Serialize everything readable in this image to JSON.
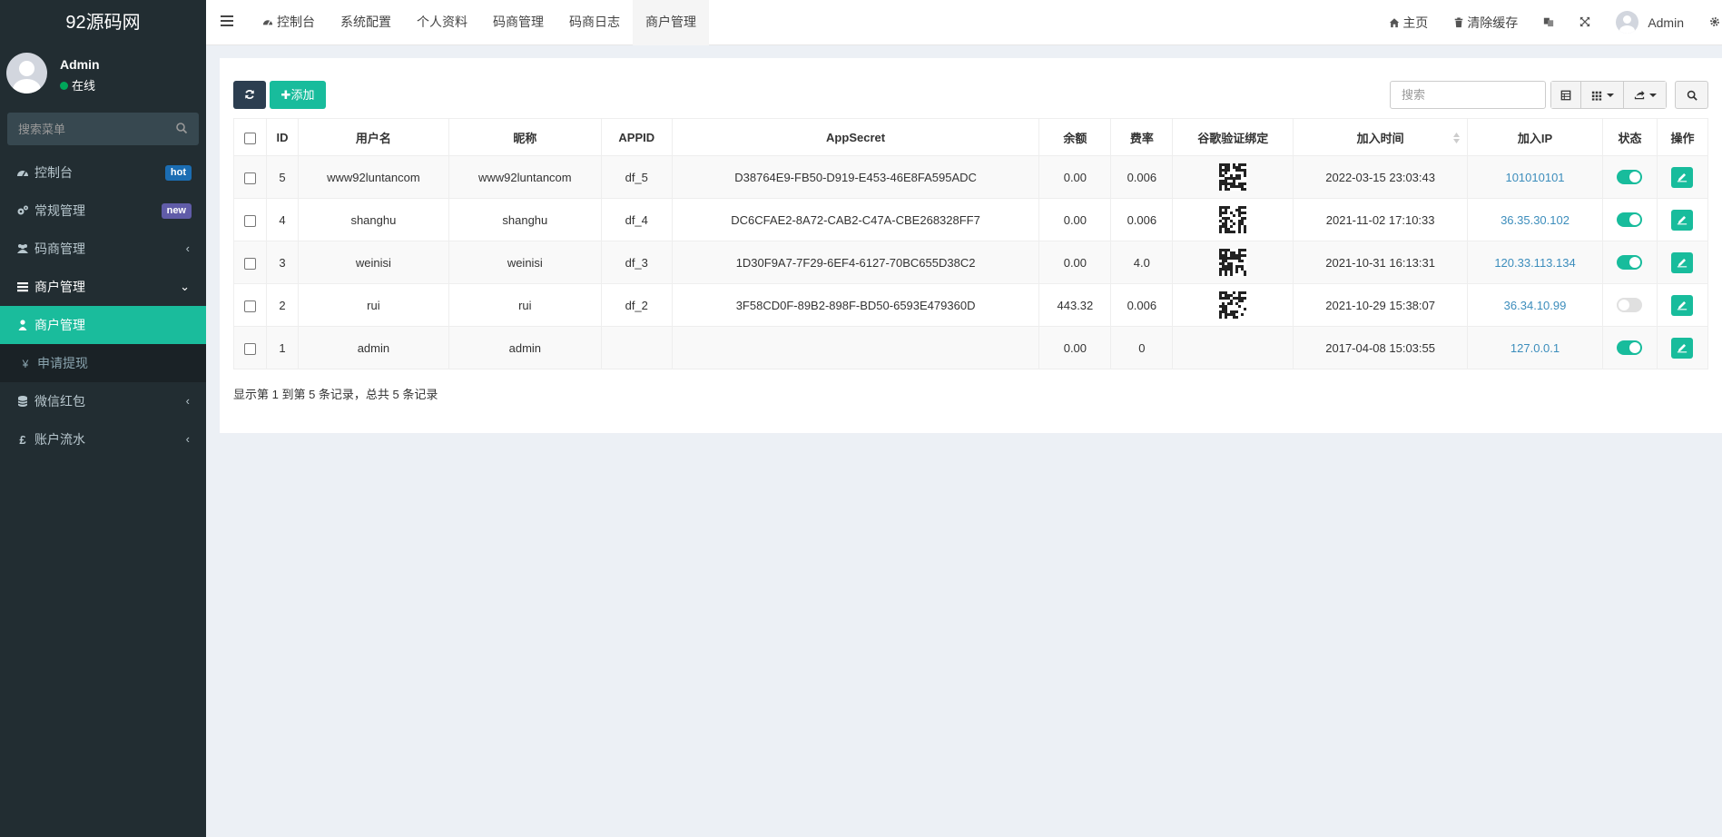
{
  "brand": {
    "title": "92源码网"
  },
  "user": {
    "name": "Admin",
    "status": "在线"
  },
  "sidebar": {
    "search_placeholder": "搜索菜单",
    "items": [
      {
        "label": "控制台",
        "badge": "hot"
      },
      {
        "label": "常规管理",
        "badge": "new"
      },
      {
        "label": "码商管理"
      },
      {
        "label": "商户管理"
      },
      {
        "label": "商户管理"
      },
      {
        "label": "申请提现"
      },
      {
        "label": "微信红包"
      },
      {
        "label": "账户流水"
      }
    ]
  },
  "topbar": {
    "tabs": [
      "控制台",
      "系统配置",
      "个人资料",
      "码商管理",
      "码商日志",
      "商户管理"
    ],
    "home": "主页",
    "clear_cache": "清除缓存",
    "admin": "Admin"
  },
  "toolbar": {
    "add_label": "添加",
    "search_placeholder": "搜索"
  },
  "table": {
    "headers": [
      "ID",
      "用户名",
      "昵称",
      "APPID",
      "AppSecret",
      "余额",
      "费率",
      "谷歌验证绑定",
      "加入时间",
      "加入IP",
      "状态",
      "操作"
    ],
    "rows": [
      {
        "id": "5",
        "username": "www92luntancom",
        "nickname": "www92luntancom",
        "appid": "df_5",
        "secret": "D38764E9-FB50-D919-E453-46E8FA595ADC",
        "balance": "0.00",
        "rate": "0.006",
        "google_bound": true,
        "joined": "2022-03-15 23:03:43",
        "ip": "101010101",
        "enabled": true
      },
      {
        "id": "4",
        "username": "shanghu",
        "nickname": "shanghu",
        "appid": "df_4",
        "secret": "DC6CFAE2-8A72-CAB2-C47A-CBE268328FF7",
        "balance": "0.00",
        "rate": "0.006",
        "google_bound": true,
        "joined": "2021-11-02 17:10:33",
        "ip": "36.35.30.102",
        "enabled": true
      },
      {
        "id": "3",
        "username": "weinisi",
        "nickname": "weinisi",
        "appid": "df_3",
        "secret": "1D30F9A7-7F29-6EF4-6127-70BC655D38C2",
        "balance": "0.00",
        "rate": "4.0",
        "google_bound": true,
        "joined": "2021-10-31 16:13:31",
        "ip": "120.33.113.134",
        "enabled": true
      },
      {
        "id": "2",
        "username": "rui",
        "nickname": "rui",
        "appid": "df_2",
        "secret": "3F58CD0F-89B2-898F-BD50-6593E479360D",
        "balance": "443.32",
        "rate": "0.006",
        "google_bound": true,
        "joined": "2021-10-29 15:38:07",
        "ip": "36.34.10.99",
        "enabled": false
      },
      {
        "id": "1",
        "username": "admin",
        "nickname": "admin",
        "appid": "",
        "secret": "",
        "balance": "0.00",
        "rate": "0",
        "google_bound": false,
        "joined": "2017-04-08 15:03:55",
        "ip": "127.0.0.1",
        "enabled": true
      }
    ]
  },
  "pagination": {
    "summary": "显示第 1 到第 5 条记录，总共 5 条记录"
  },
  "colors": {
    "accent": "#18bc9c",
    "sidebar_bg": "#222d32",
    "dark_button": "#2c3e50",
    "link": "#3c8dbc"
  }
}
